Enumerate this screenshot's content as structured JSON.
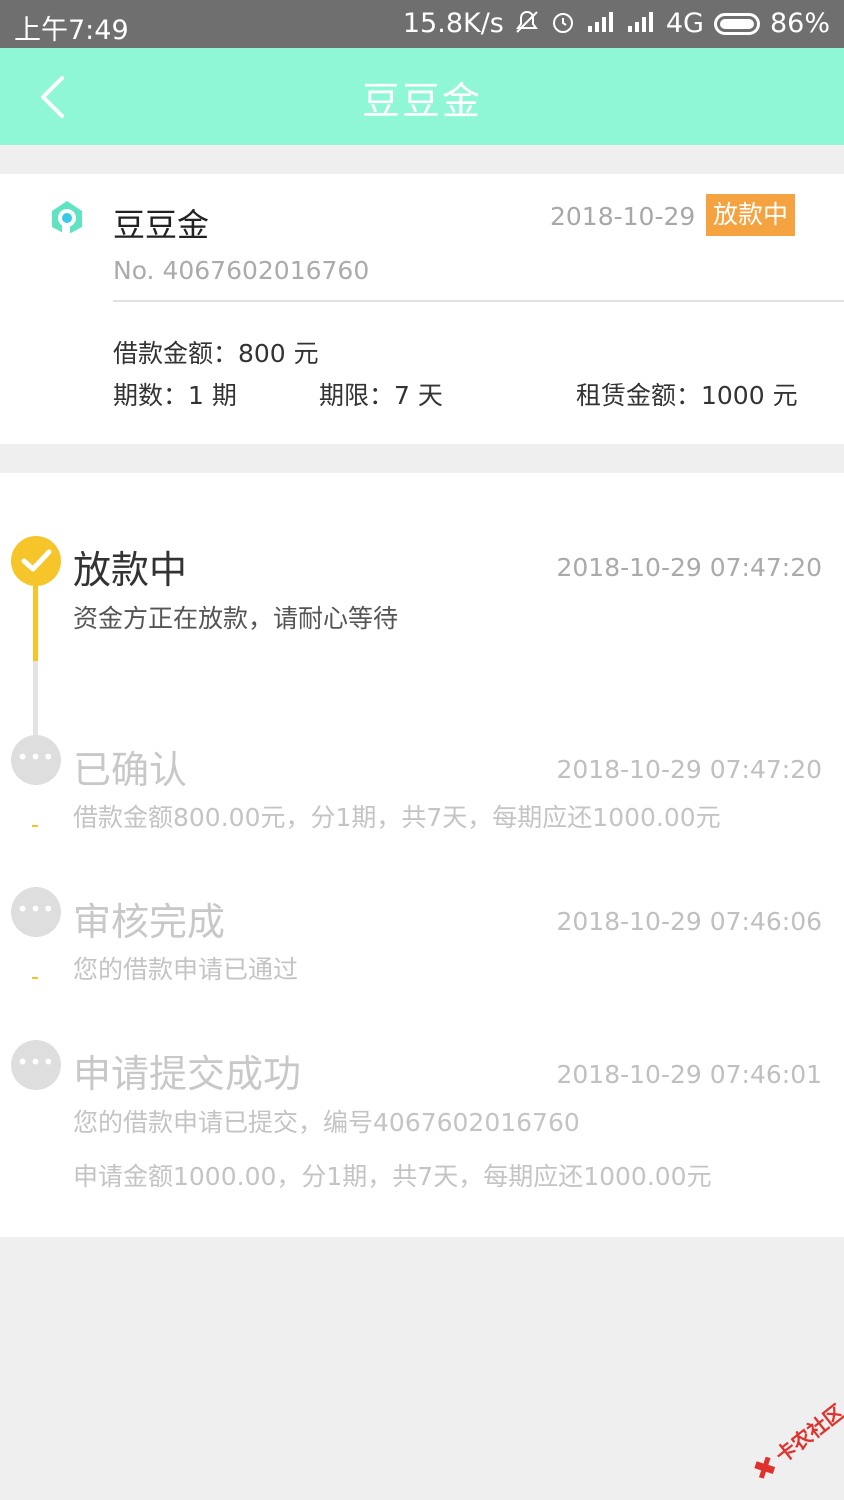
{
  "status_bar": {
    "time": "上午7:49",
    "net_speed": "15.8K/s",
    "network": "4G",
    "battery": "86%"
  },
  "app_bar": {
    "title": "豆豆金"
  },
  "loan": {
    "brand": "豆豆金",
    "date": "2018-10-29",
    "status": "放款中",
    "number": "No. 4067602016760",
    "amount": "借款金额：800 元",
    "terms": "期数：1 期",
    "limit": "期限：7 天",
    "rent": "租赁金额：1000 元"
  },
  "timeline": [
    {
      "title": "放款中",
      "time": "2018-10-29 07:47:20",
      "desc": "资金方正在放款，请耐心等待",
      "state": "done"
    },
    {
      "title": "已确认",
      "time": "2018-10-29 07:47:20",
      "desc": "借款金额800.00元，分1期，共7天，每期应还1000.00元",
      "state": "pending"
    },
    {
      "title": "审核完成",
      "time": "2018-10-29 07:46:06",
      "desc": "您的借款申请已通过",
      "state": "pending"
    },
    {
      "title": "申请提交成功",
      "time": "2018-10-29 07:46:01",
      "desc": "您的借款申请已提交，编号4067602016760",
      "desc2": "申请金额1000.00，分1期，共7天，每期应还1000.00元",
      "state": "pending"
    }
  ],
  "watermark": {
    "text": "卡农社区"
  },
  "colors": {
    "app_bar": "#8ff7d6",
    "badge": "#f5a340",
    "timeline_active": "#f6c52a"
  },
  "icons": {
    "back": "chevron-left-icon",
    "brand": "brand-logo-icon",
    "done": "check-circle-icon",
    "pending": "ellipsis-circle-icon"
  }
}
